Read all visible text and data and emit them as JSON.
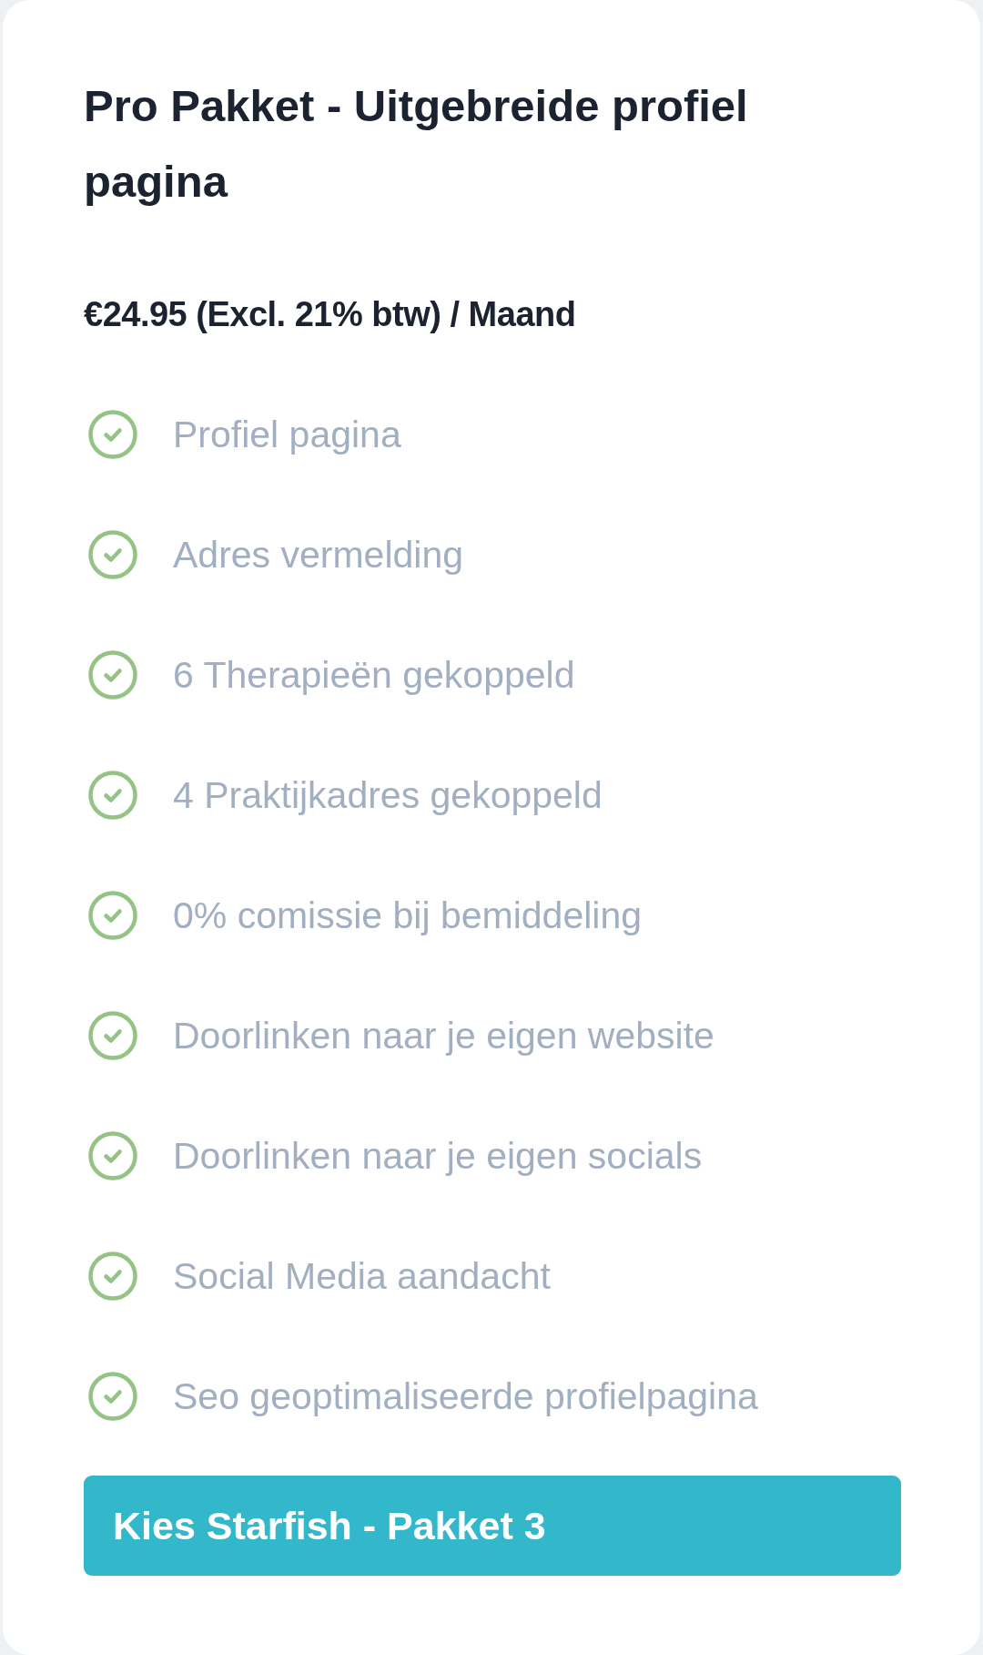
{
  "plan": {
    "title": "Pro Pakket - Uitgebreide profiel pagina",
    "price": "€24.95 (Excl. 21% btw) / Maand"
  },
  "features": [
    {
      "label": "Profiel pagina",
      "included": true
    },
    {
      "label": "Adres vermelding",
      "included": true
    },
    {
      "label": "6 Therapieën gekoppeld",
      "included": true
    },
    {
      "label": "4 Praktijkadres gekoppeld",
      "included": true
    },
    {
      "label": "0% comissie bij bemiddeling",
      "included": true
    },
    {
      "label": "Doorlinken naar je eigen website",
      "included": true
    },
    {
      "label": "Doorlinken naar je eigen socials",
      "included": true
    },
    {
      "label": "Social Media aandacht",
      "included": true
    },
    {
      "label": "Seo geoptimaliseerde profielpagina",
      "included": true
    }
  ],
  "button": {
    "label": "Kies Starfish - Pakket 3"
  }
}
